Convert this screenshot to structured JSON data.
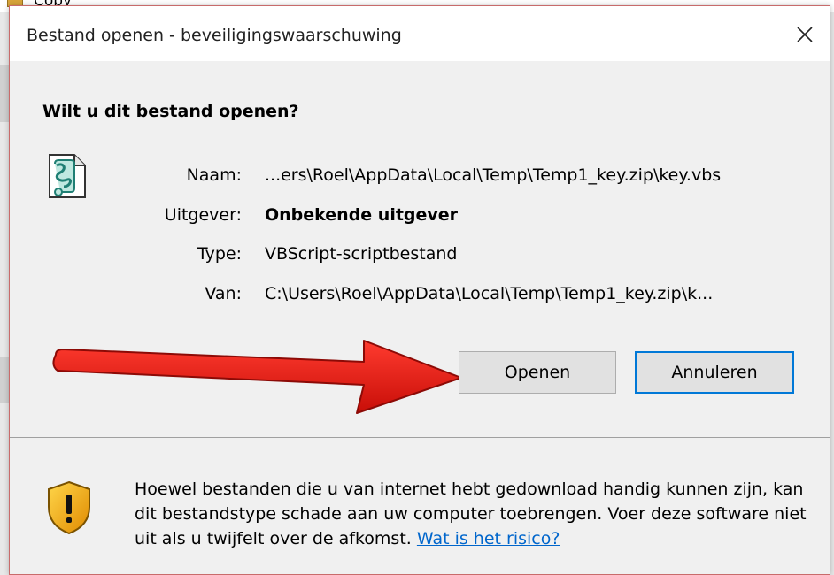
{
  "background_window": {
    "title_fragment": "Copy"
  },
  "dialog": {
    "title": "Bestand openen - beveiligingswaarschuwing",
    "question": "Wilt u dit bestand openen?",
    "file_icon": "vbscript-file-icon",
    "fields": [
      {
        "label": "Naam:",
        "value": "...ers\\Roel\\AppData\\Local\\Temp\\Temp1_key.zip\\key.vbs",
        "bold": false
      },
      {
        "label": "Uitgever:",
        "value": "Onbekende uitgever",
        "bold": true
      },
      {
        "label": "Type:",
        "value": "VBScript-scriptbestand",
        "bold": false
      },
      {
        "label": "Van:",
        "value": "C:\\Users\\Roel\\AppData\\Local\\Temp\\Temp1_key.zip\\k...",
        "bold": false
      }
    ],
    "buttons": {
      "open_label": "Openen",
      "cancel_label": "Annuleren"
    },
    "warning": {
      "icon": "shield-warning-icon",
      "text": "Hoewel bestanden die u van internet hebt gedownload handig kunnen zijn, kan dit bestandstype schade aan uw computer toebrengen. Voer deze software niet uit als u twijfelt over de afkomst.",
      "link_text": "Wat is het risico?"
    }
  },
  "colors": {
    "accent": "#0078d7",
    "link": "#0066cc",
    "arrow": "#e8140e"
  }
}
